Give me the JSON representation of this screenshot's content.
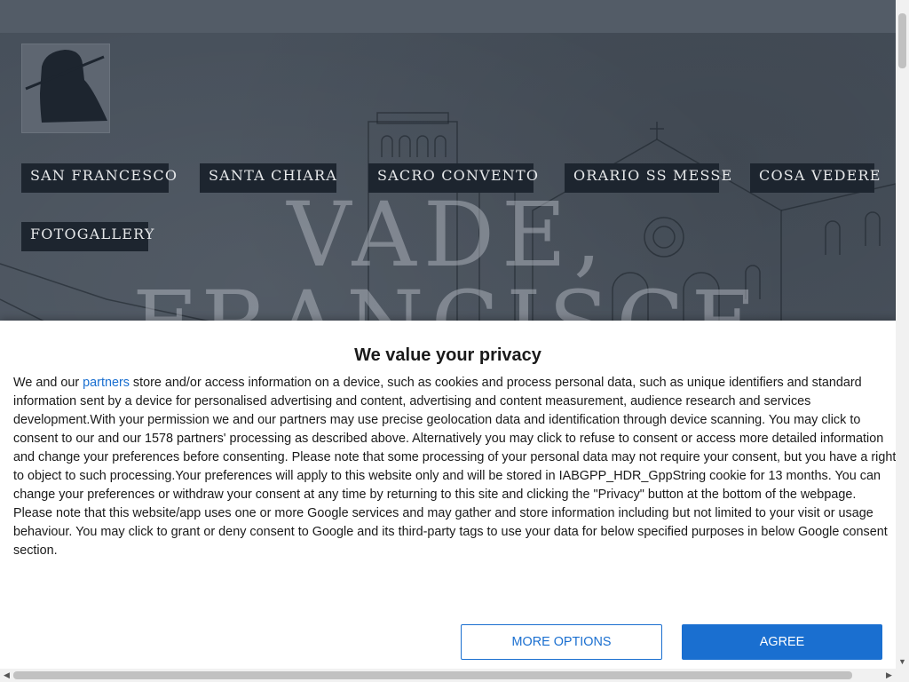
{
  "navigation": {
    "items": [
      {
        "label": "SAN FRANCESCO"
      },
      {
        "label": "SANTA CHIARA"
      },
      {
        "label": "SACRO CONVENTO"
      },
      {
        "label": "ORARIO SS MESSE"
      },
      {
        "label": "COSA VEDERE"
      },
      {
        "label": "FOTOGALLERY"
      }
    ]
  },
  "hero": {
    "title_line1": "VADE,",
    "title_line2": "FRANCISCE"
  },
  "consent": {
    "title": "We value your privacy",
    "text_before_link": "We and our ",
    "link_label": "partners",
    "text_after_link": " store and/or access information on a device, such as cookies and process personal data, such as unique identifiers and standard information sent by a device for personalised advertising and content, advertising and content measurement, audience research and services development.With your permission we and our partners may use precise geolocation data and identification through device scanning. You may click to consent to our and our 1578 partners' processing as described above. Alternatively you may click to refuse to consent or access more detailed information and change your preferences before consenting. Please note that some processing of your personal data may not require your consent, but you have a right to object to such processing.Your preferences will apply to this website only and will be stored in IABGPP_HDR_GppString cookie for 13 months. You can change your preferences or withdraw your consent at any time by returning to this site and clicking the \"Privacy\" button at the bottom of the webpage. Please note that this website/app uses one or more Google services and may gather and store information including but not limited to your visit or usage behaviour. You may click to grant or deny consent to Google and its third-party tags to use your data for below specified purposes in below Google consent section.",
    "more_options_label": "MORE OPTIONS",
    "agree_label": "AGREE"
  },
  "colors": {
    "nav_bg": "#1d252f",
    "accent": "#1a6fd0",
    "hero_bg": "#4a535e"
  },
  "icons": {
    "logo": "friar-silhouette-logo",
    "scroll_up": "arrow-up-icon",
    "scroll_down": "arrow-down-icon",
    "scroll_left": "arrow-left-icon",
    "scroll_right": "arrow-right-icon"
  }
}
